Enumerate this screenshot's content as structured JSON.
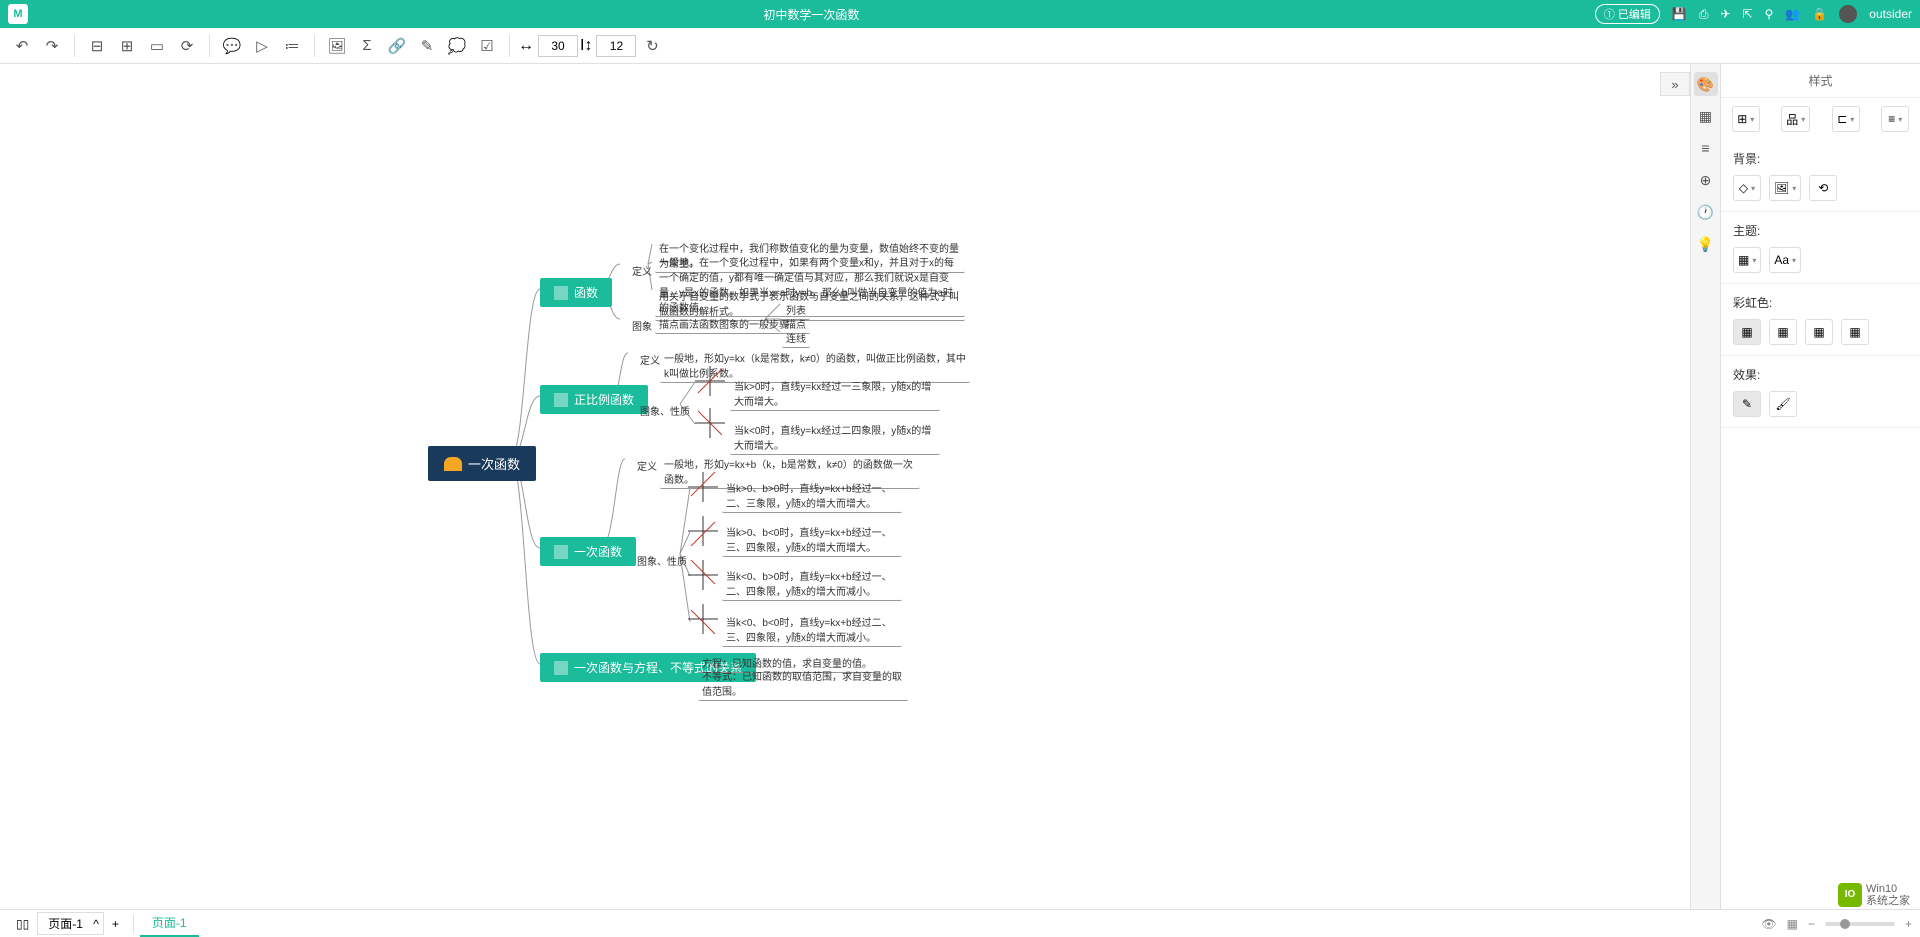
{
  "titlebar": {
    "title": "初中数学一次函数",
    "edited": "已编辑",
    "username": "outsider"
  },
  "toolbar": {
    "width_value": "30",
    "height_value": "12"
  },
  "style_panel": {
    "title": "样式",
    "background_label": "背景:",
    "theme_label": "主题:",
    "font_label": "Aa",
    "rainbow_label": "彩虹色:",
    "effect_label": "效果:"
  },
  "bottombar": {
    "page_label": "页面-1",
    "tab_label": "页面-1"
  },
  "mindmap": {
    "root": "一次函数",
    "branches": [
      {
        "title": "函数",
        "children": [
          {
            "label": "定义",
            "items": [
              "在一个变化过程中，我们称数值变化的量为变量，数值始终不变的量为常量。",
              "一般地，在一个变化过程中，如果有两个变量x和y，并且对于x的每一个确定的值，y都有唯一确定值与其对应，那么我们就说x是自变量，y是x的函数。如果当x=a时y=b，那么b叫做当自变量的值为a时的函数值。",
              "用关于自变量的数学式子表示函数与自变量之间的关系，这种式子叫做函数的解析式。"
            ]
          },
          {
            "label": "图象",
            "intro": "描点画法函数图象的一般步骤",
            "items": [
              "列表",
              "描点",
              "连线"
            ]
          }
        ]
      },
      {
        "title": "正比例函数",
        "children": [
          {
            "label": "定义",
            "items": [
              "一般地，形如y=kx（k是常数，k≠0）的函数，叫做正比例函数，其中k叫做比例系数。"
            ]
          },
          {
            "label": "图象、性质",
            "items": [
              "当k>0时，直线y=kx经过一三象限，y随x的增大而增大。",
              "当k<0时，直线y=kx经过二四象限，y随x的增大而增大。"
            ]
          }
        ]
      },
      {
        "title": "一次函数",
        "children": [
          {
            "label": "定义",
            "items": [
              "一般地，形如y=kx+b（k，b是常数，k≠0）的函数做一次函数。"
            ]
          },
          {
            "label": "图象、性质",
            "items": [
              "当k>0、b>0时，直线y=kx+b经过一、二、三象限，y随x的增大而增大。",
              "当k>0、b<0时，直线y=kx+b经过一、三、四象限，y随x的增大而增大。",
              "当k<0、b>0时，直线y=kx+b经过一、二、四象限，y随x的增大而减小。",
              "当k<0、b<0时，直线y=kx+b经过二、三、四象限，y随x的增大而减小。"
            ]
          }
        ]
      },
      {
        "title": "一次函数与方程、不等式的关系",
        "children": [
          {
            "label": "",
            "items": [
              "方程：已知函数的值，求自变量的值。",
              "不等式：已知函数的取值范围，求自变量的取值范围。"
            ]
          }
        ]
      }
    ]
  },
  "watermark": {
    "brand": "Win10",
    "sub": "系统之家"
  }
}
